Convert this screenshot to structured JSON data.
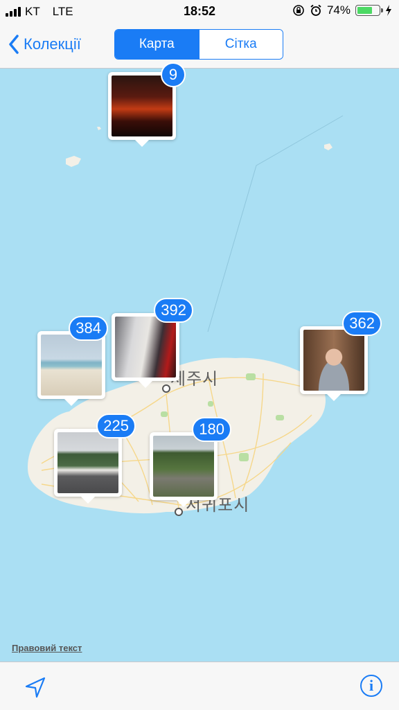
{
  "status": {
    "carrier": "KT",
    "network": "LTE",
    "time": "18:52",
    "battery": "74%",
    "battery_level": 0.74
  },
  "nav": {
    "back_label": "Колекції",
    "segments": [
      "Карта",
      "Сітка"
    ],
    "selected": "Карта"
  },
  "map": {
    "city_north": "제주시",
    "city_south": "서귀포시",
    "legal": "Правовий текст",
    "clusters": [
      {
        "count": "9",
        "desc": "sunset"
      },
      {
        "count": "384",
        "desc": "beach"
      },
      {
        "count": "392",
        "desc": "car-dog"
      },
      {
        "count": "362",
        "desc": "selfie"
      },
      {
        "count": "225",
        "desc": "parking"
      },
      {
        "count": "180",
        "desc": "path"
      }
    ]
  },
  "colors": {
    "accent": "#1a7cf5",
    "water": "#aadff3",
    "land": "#f3f0e7"
  }
}
